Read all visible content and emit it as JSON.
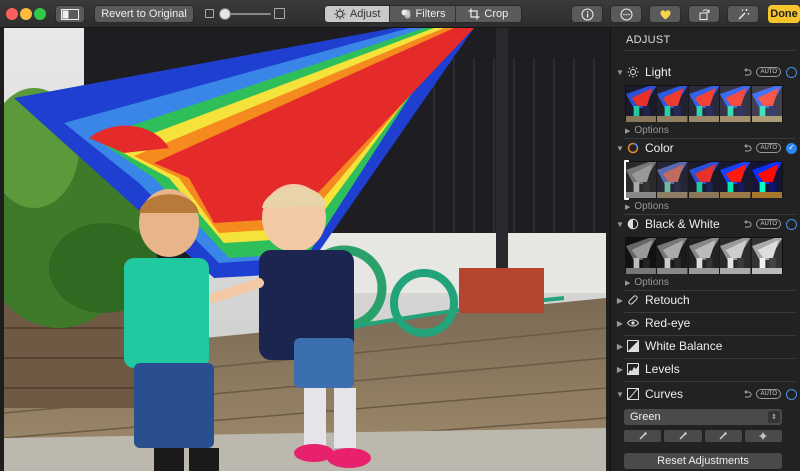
{
  "toolbar": {
    "revert_label": "Revert to Original",
    "tabs": [
      {
        "label": "Adjust",
        "icon": "adjust-dial-icon",
        "active": true
      },
      {
        "label": "Filters",
        "icon": "filters-circles-icon",
        "active": false
      },
      {
        "label": "Crop",
        "icon": "crop-icon",
        "active": false
      }
    ],
    "done_label": "Done",
    "colors": {
      "done": "#f5c52b",
      "active_tab": "#c9c9c9",
      "favorite": "#f5d64a"
    }
  },
  "panel": {
    "title": "ADJUST",
    "sections": [
      {
        "label": "Light",
        "icon": "sun-icon",
        "auto": "AUTO",
        "enabled": false,
        "options": "Options"
      },
      {
        "label": "Color",
        "icon": "color-ring-icon",
        "auto": "AUTO",
        "enabled": true,
        "options": "Options"
      },
      {
        "label": "Black & White",
        "icon": "half-circle-icon",
        "auto": "AUTO",
        "enabled": false,
        "options": "Options"
      }
    ],
    "tools": [
      {
        "label": "Retouch",
        "icon": "bandage-icon"
      },
      {
        "label": "Red-eye",
        "icon": "eye-icon"
      },
      {
        "label": "White Balance",
        "icon": "white-balance-icon"
      },
      {
        "label": "Levels",
        "icon": "levels-icon"
      }
    ],
    "curves": {
      "label": "Curves",
      "icon": "curves-icon",
      "auto": "AUTO",
      "enabled": false,
      "channel": "Green"
    },
    "reset_label": "Reset Adjustments",
    "accent": "#2f86f0"
  }
}
